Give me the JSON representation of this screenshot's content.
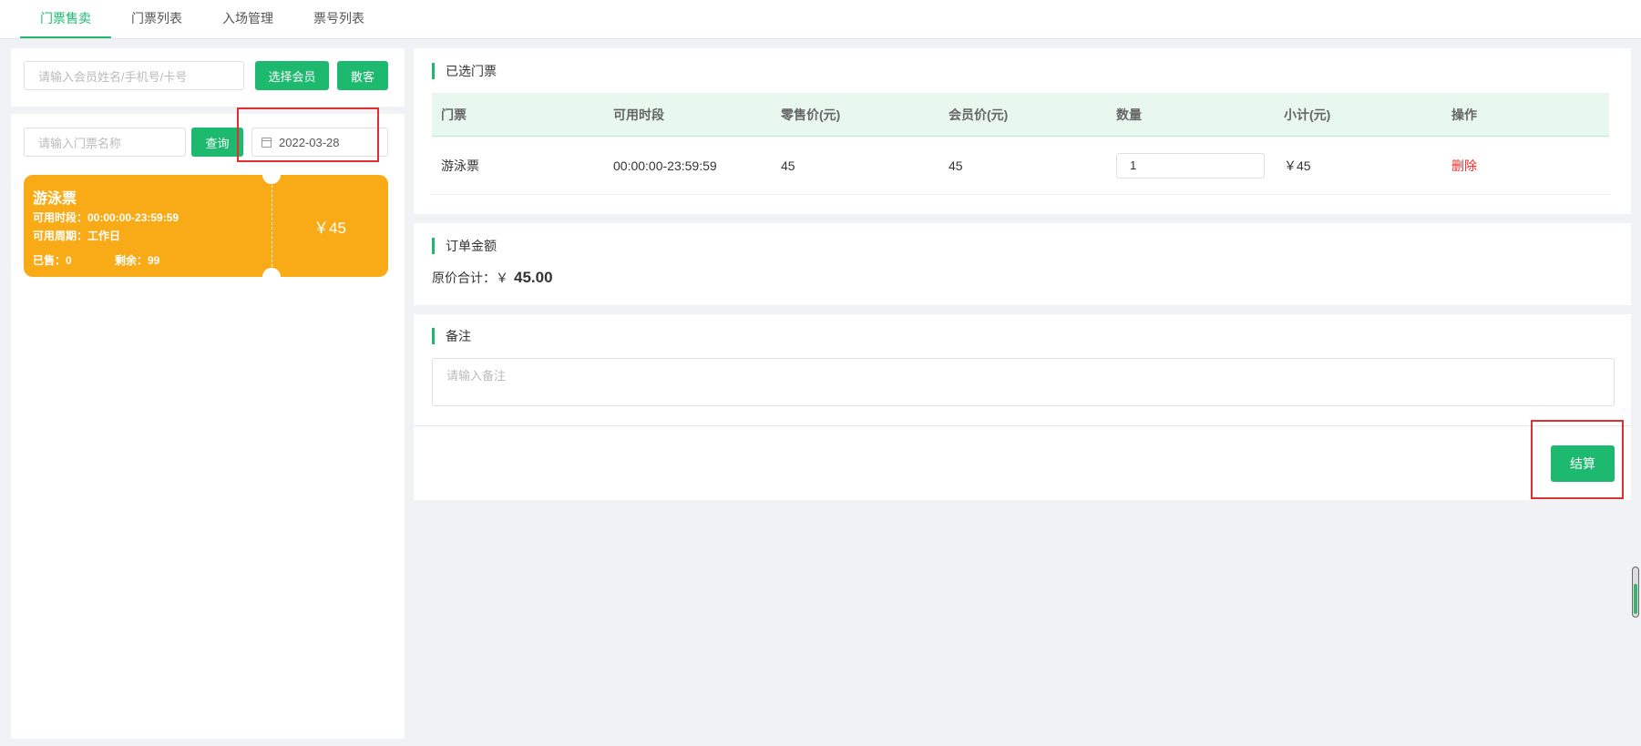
{
  "tabs": [
    "门票售卖",
    "门票列表",
    "入场管理",
    "票号列表"
  ],
  "member": {
    "placeholder": "请输入会员姓名/手机号/卡号",
    "select_label": "选择会员",
    "guest_label": "散客"
  },
  "ticket_search": {
    "placeholder": "请输入门票名称",
    "query_label": "查询",
    "date": "2022-03-28"
  },
  "ticket_card": {
    "name": "游泳票",
    "time": "可用时段：00:00:00-23:59:59",
    "cycle": "可用周期：工作日",
    "sold": "已售：0",
    "remain": "剩余：99",
    "price": "￥45"
  },
  "selected": {
    "title": "已选门票",
    "columns": [
      "门票",
      "可用时段",
      "零售价(元)",
      "会员价(元)",
      "数量",
      "小计(元)",
      "操作"
    ],
    "rows": [
      {
        "ticket": "游泳票",
        "time": "00:00:00-23:59:59",
        "retail": "45",
        "member_price": "45",
        "qty": "1",
        "subtotal": "￥45",
        "action": "删除"
      }
    ]
  },
  "amount": {
    "title": "订单金额",
    "label": "原价合计：￥",
    "value": "45.00"
  },
  "remark": {
    "title": "备注",
    "placeholder": "请输入备注"
  },
  "submit_label": "结算",
  "colors": {
    "accent": "#1db96f",
    "card": "#f9ab17",
    "danger": "#f02c2c",
    "highlight": "#e02f2f"
  }
}
